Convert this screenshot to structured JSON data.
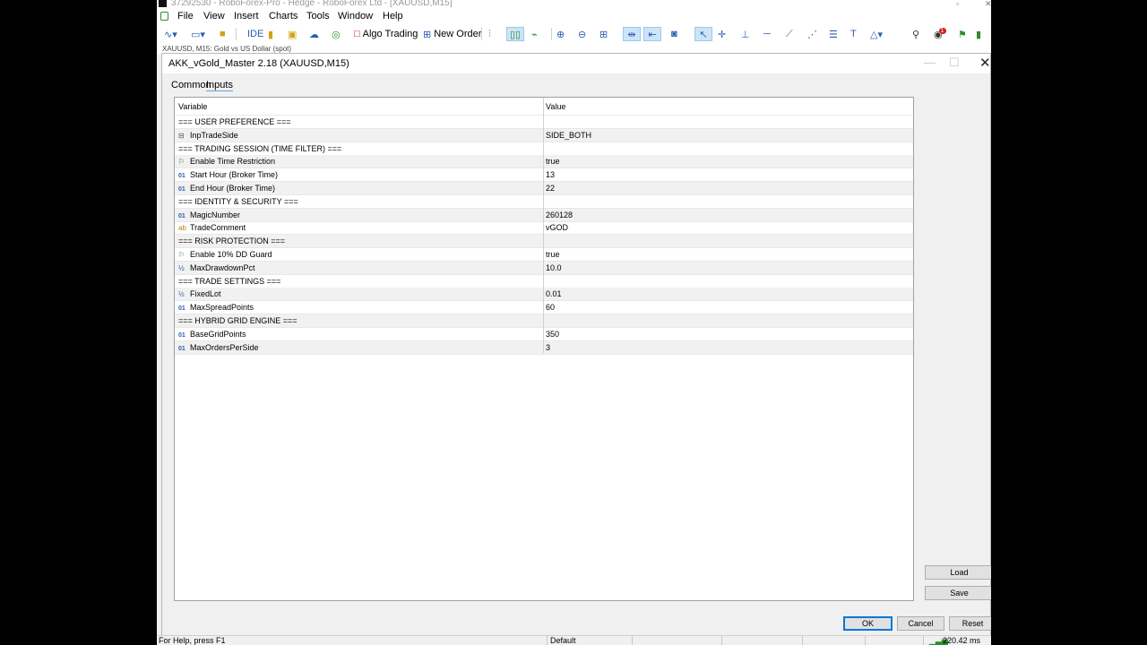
{
  "window": {
    "title": "37292530 - RoboForex-Pro - Hedge - RoboForex Ltd - [XAUUSD,M15]"
  },
  "menu": [
    "File",
    "View",
    "Insert",
    "Charts",
    "Tools",
    "Window",
    "Help"
  ],
  "toolbar": {
    "ide": "IDE",
    "algo_trading": "Algo Trading",
    "new_order": "New Order",
    "notification_count": "1"
  },
  "chart_tab": {
    "label": "XAUUSD, M15:  Gold vs US Dollar (spot)"
  },
  "dialog": {
    "title": "AKK_vGold_Master 2.18 (XAUUSD,M15)",
    "tabs": [
      "Common",
      "Inputs"
    ],
    "columns": [
      "Variable",
      "Value"
    ],
    "rows": [
      {
        "icon": "",
        "variable": "=== USER PREFERENCE ===",
        "value": ""
      },
      {
        "icon": "enum",
        "variable": "InpTradeSide",
        "value": "SIDE_BOTH"
      },
      {
        "icon": "",
        "variable": "=== TRADING SESSION (TIME FILTER) ===",
        "value": ""
      },
      {
        "icon": "bool",
        "variable": "Enable Time Restriction",
        "value": "true"
      },
      {
        "icon": "int",
        "variable": "Start Hour (Broker Time)",
        "value": "13"
      },
      {
        "icon": "int",
        "variable": "End Hour (Broker Time)",
        "value": "22"
      },
      {
        "icon": "",
        "variable": "=== IDENTITY & SECURITY ===",
        "value": ""
      },
      {
        "icon": "int",
        "variable": "MagicNumber",
        "value": "260128"
      },
      {
        "icon": "str",
        "variable": "TradeComment",
        "value": "vGOD"
      },
      {
        "icon": "",
        "variable": "=== RISK PROTECTION ===",
        "value": ""
      },
      {
        "icon": "bool",
        "variable": "Enable 10% DD Guard",
        "value": "true"
      },
      {
        "icon": "dbl",
        "variable": "MaxDrawdownPct",
        "value": "10.0"
      },
      {
        "icon": "",
        "variable": "=== TRADE SETTINGS ===",
        "value": ""
      },
      {
        "icon": "dbl",
        "variable": "FixedLot",
        "value": "0.01"
      },
      {
        "icon": "int",
        "variable": "MaxSpreadPoints",
        "value": "60"
      },
      {
        "icon": "",
        "variable": "=== HYBRID GRID ENGINE ===",
        "value": ""
      },
      {
        "icon": "int",
        "variable": "BaseGridPoints",
        "value": "350"
      },
      {
        "icon": "int",
        "variable": "MaxOrdersPerSide",
        "value": "3"
      }
    ],
    "buttons": {
      "load": "Load",
      "save": "Save",
      "ok": "OK",
      "cancel": "Cancel",
      "reset": "Reset"
    }
  },
  "statusbar": {
    "help": "For Help, press F1",
    "profile": "Default",
    "ping": "220.42 ms"
  }
}
